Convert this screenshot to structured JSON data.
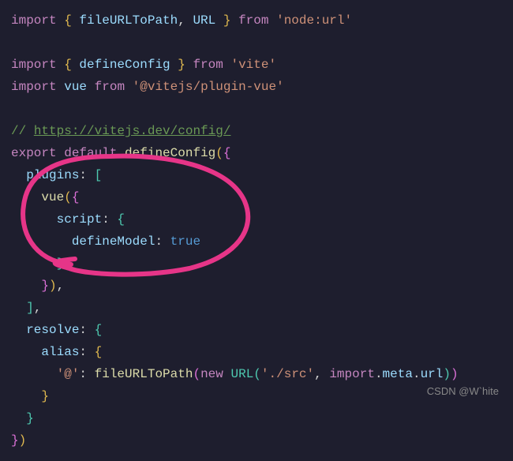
{
  "code": {
    "l1_import": "import",
    "l1_brace_open": " { ",
    "l1_id1": "fileURLToPath",
    "l1_sep": ", ",
    "l1_id2": "URL",
    "l1_brace_close": " } ",
    "l1_from": "from",
    "l1_sp": " ",
    "l1_str": "'node:url'",
    "l3_import": "import",
    "l3_brace_open": " { ",
    "l3_id": "defineConfig",
    "l3_brace_close": " } ",
    "l3_from": "from",
    "l3_sp": " ",
    "l3_str": "'vite'",
    "l4_import": "import",
    "l4_sp1": " ",
    "l4_id": "vue",
    "l4_sp2": " ",
    "l4_from": "from",
    "l4_sp3": " ",
    "l4_str": "'@vitejs/plugin-vue'",
    "l6_comment_pre": "// ",
    "l6_comment_link": "https://vitejs.dev/config/",
    "l7_export": "export",
    "l7_sp1": " ",
    "l7_default": "default",
    "l7_sp2": " ",
    "l7_fn": "defineConfig",
    "l7_paren_open": "(",
    "l7_brace_open": "{",
    "l8_indent": "  ",
    "l8_prop": "plugins",
    "l8_colon": ": ",
    "l8_bracket": "[",
    "l9_indent": "    ",
    "l9_fn": "vue",
    "l9_paren_open": "(",
    "l9_brace_open": "{",
    "l10_indent": "      ",
    "l10_prop": "script",
    "l10_colon": ": ",
    "l10_brace": "{",
    "l11_indent": "        ",
    "l11_prop": "defineModel",
    "l11_colon": ": ",
    "l11_val": "true",
    "l12_indent": "      ",
    "l12_brace": "}",
    "l13_indent": "    ",
    "l13_brace": "}",
    "l13_paren": ")",
    "l13_comma": ",",
    "l14_indent": "  ",
    "l14_bracket": "]",
    "l14_comma": ",",
    "l15_indent": "  ",
    "l15_prop": "resolve",
    "l15_colon": ": ",
    "l15_brace": "{",
    "l16_indent": "    ",
    "l16_prop": "alias",
    "l16_colon": ": ",
    "l16_brace": "{",
    "l17_indent": "      ",
    "l17_key": "'@'",
    "l17_colon": ": ",
    "l17_fn": "fileURLToPath",
    "l17_paren_open": "(",
    "l17_new": "new",
    "l17_sp": " ",
    "l17_class": "URL",
    "l17_paren_open2": "(",
    "l17_str1": "'./src'",
    "l17_sep": ", ",
    "l17_import_kw": "import",
    "l17_dot": ".",
    "l17_meta": "meta",
    "l17_dot2": ".",
    "l17_url": "url",
    "l17_paren_close2": ")",
    "l17_paren_close": ")",
    "l18_indent": "    ",
    "l18_brace": "}",
    "l19_indent": "  ",
    "l19_brace": "}",
    "l20_brace": "}",
    "l20_paren": ")"
  },
  "watermark": "CSDN @W`hite"
}
